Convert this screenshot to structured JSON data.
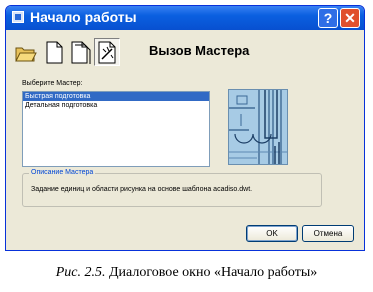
{
  "window": {
    "title": "Начало работы",
    "help_glyph": "?",
    "close_glyph": "✕"
  },
  "toolbar": {
    "buttons": [
      {
        "icon": "open-folder-icon"
      },
      {
        "icon": "blank-page-icon"
      },
      {
        "icon": "template-page-icon"
      },
      {
        "icon": "wizard-icon",
        "pressed": true
      }
    ],
    "heading": "Вызов Мастера"
  },
  "wizard_select": {
    "label": "Выберите Мастер:",
    "items": [
      {
        "label": "Быстрая подготовка",
        "selected": true
      },
      {
        "label": "Детальная подготовка",
        "selected": false
      }
    ]
  },
  "description": {
    "legend": "Описание Мастера",
    "text": "Задание единиц и области рисунка на основе шаблона acadiso.dwt."
  },
  "buttons": {
    "ok": "OK",
    "cancel": "Отмена"
  },
  "caption": {
    "lead": "Рис. 2.5.",
    "text": " Диалоговое окно «Начало работы»"
  },
  "colors": {
    "titlebar": "#0a5fe0",
    "dialog_bg": "#ece9d8",
    "selection": "#316ac5",
    "preview_bg": "#9fc4e0"
  }
}
